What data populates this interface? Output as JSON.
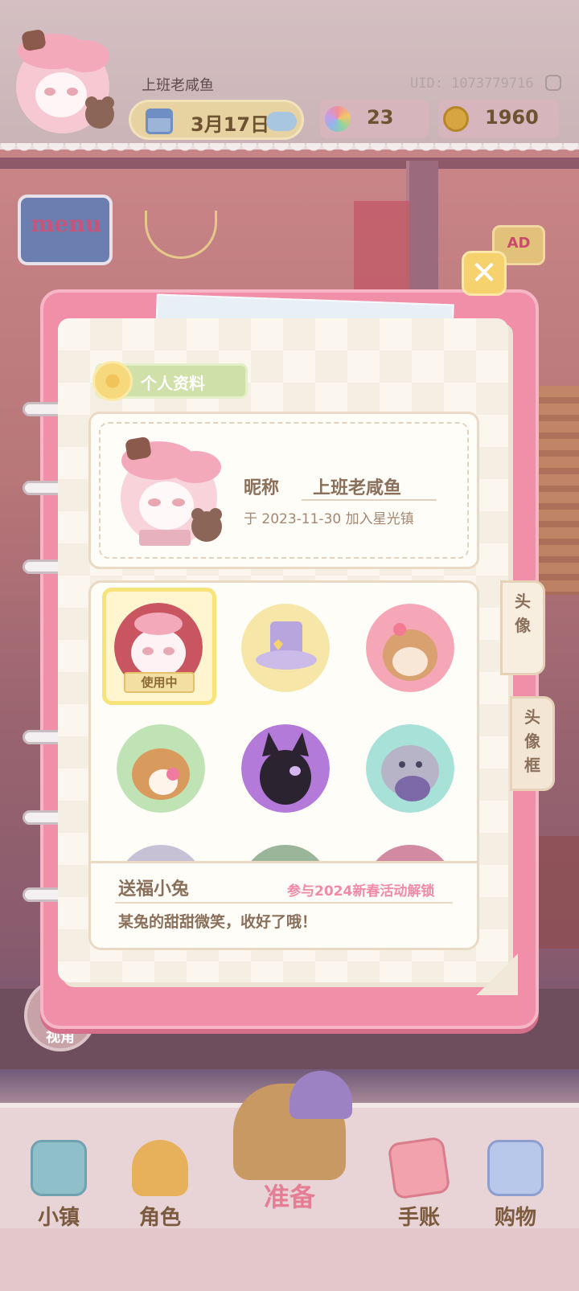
{
  "header": {
    "player_name": "上班老咸鱼",
    "uid_text": "UID: 1073779716",
    "date": "3月17日",
    "gems": "23",
    "coins": "1960"
  },
  "menu": {
    "label": "menu"
  },
  "ad": {
    "label": "AD"
  },
  "view_button": {
    "label": "视角"
  },
  "dialog": {
    "close_label": "✕",
    "section_title": "个人资料",
    "nickname_label": "昵称",
    "nickname_value": "上班老咸鱼",
    "join_text": "于 2023-11-30 加入星光镇",
    "in_use_badge": "使用中",
    "tabs": [
      {
        "label": "头像"
      },
      {
        "label": "头像框"
      }
    ],
    "selected_frame": {
      "name": "送福小兔",
      "unlock": "参与2024新春活动解锁",
      "description": "某兔的甜甜微笑，收好了哦！"
    }
  },
  "bottom_nav": {
    "items": [
      {
        "label": "小镇"
      },
      {
        "label": "角色"
      },
      {
        "label": "准备"
      },
      {
        "label": "手账"
      },
      {
        "label": "购物"
      }
    ]
  },
  "colors": {
    "accent_pink": "#f28fa8",
    "paper": "#fbf7ee",
    "text_brown": "#8a6f5b",
    "unlock_pink": "#f28aa6",
    "selected_yellow": "#f8e27a"
  }
}
